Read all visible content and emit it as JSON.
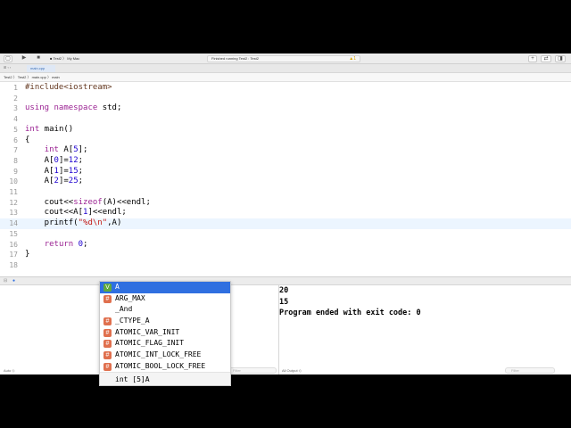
{
  "toolbar": {
    "scheme": "Test2",
    "destination": "My Mac",
    "status": "Finished running Test2 : Test2",
    "warning_count": "1"
  },
  "tabs": [
    {
      "label": "main.cpp"
    }
  ],
  "jumpbar": [
    "Test2",
    "Test2",
    "main.cpp",
    "main"
  ],
  "editor": {
    "lines": [
      {
        "n": "1",
        "html": "<span class='pp'>#include&lt;iostream&gt;</span>"
      },
      {
        "n": "2",
        "html": ""
      },
      {
        "n": "3",
        "html": "<span class='kw'>using namespace</span> std;"
      },
      {
        "n": "4",
        "html": ""
      },
      {
        "n": "5",
        "html": "<span class='kw'>int</span> main()"
      },
      {
        "n": "6",
        "html": "{"
      },
      {
        "n": "7",
        "html": "    <span class='kw'>int</span> A[<span class='num'>5</span>];"
      },
      {
        "n": "8",
        "html": "    A[<span class='num'>0</span>]=<span class='num'>12</span>;"
      },
      {
        "n": "9",
        "html": "    A[<span class='num'>1</span>]=<span class='num'>15</span>;"
      },
      {
        "n": "10",
        "html": "    A[<span class='num'>2</span>]=<span class='num'>25</span>;"
      },
      {
        "n": "11",
        "html": ""
      },
      {
        "n": "12",
        "html": "    cout&lt;&lt;<span class='kw'>sizeof</span>(A)&lt;&lt;endl;"
      },
      {
        "n": "13",
        "html": "    cout&lt;&lt;A[<span class='num'>1</span>]&lt;&lt;endl;"
      },
      {
        "n": "14",
        "html": "    printf(<span class='str'>\"%d\\n\"</span>,A)"
      },
      {
        "n": "15",
        "html": ""
      },
      {
        "n": "16",
        "html": "    <span class='kw'>return</span> <span class='num'>0</span>;"
      },
      {
        "n": "17",
        "html": "}"
      },
      {
        "n": "18",
        "html": ""
      }
    ],
    "current_line": 14
  },
  "autocomplete": {
    "items": [
      {
        "badge": "V",
        "label": "A",
        "selected": true
      },
      {
        "badge": "#",
        "label": "ARG_MAX"
      },
      {
        "badge": "",
        "label": "_And"
      },
      {
        "badge": "#",
        "label": "_CTYPE_A"
      },
      {
        "badge": "#",
        "label": "ATOMIC_VAR_INIT"
      },
      {
        "badge": "#",
        "label": "ATOMIC_FLAG_INIT"
      },
      {
        "badge": "#",
        "label": "ATOMIC_INT_LOCK_FREE"
      },
      {
        "badge": "#",
        "label": "ATOMIC_BOOL_LOCK_FREE"
      }
    ],
    "detail": "int [5]A"
  },
  "console": {
    "output": [
      "20",
      "15",
      "Program ended with exit code: 0"
    ],
    "left_scope": "Auto",
    "right_scope": "All Output",
    "filter_placeholder": "Filter"
  }
}
